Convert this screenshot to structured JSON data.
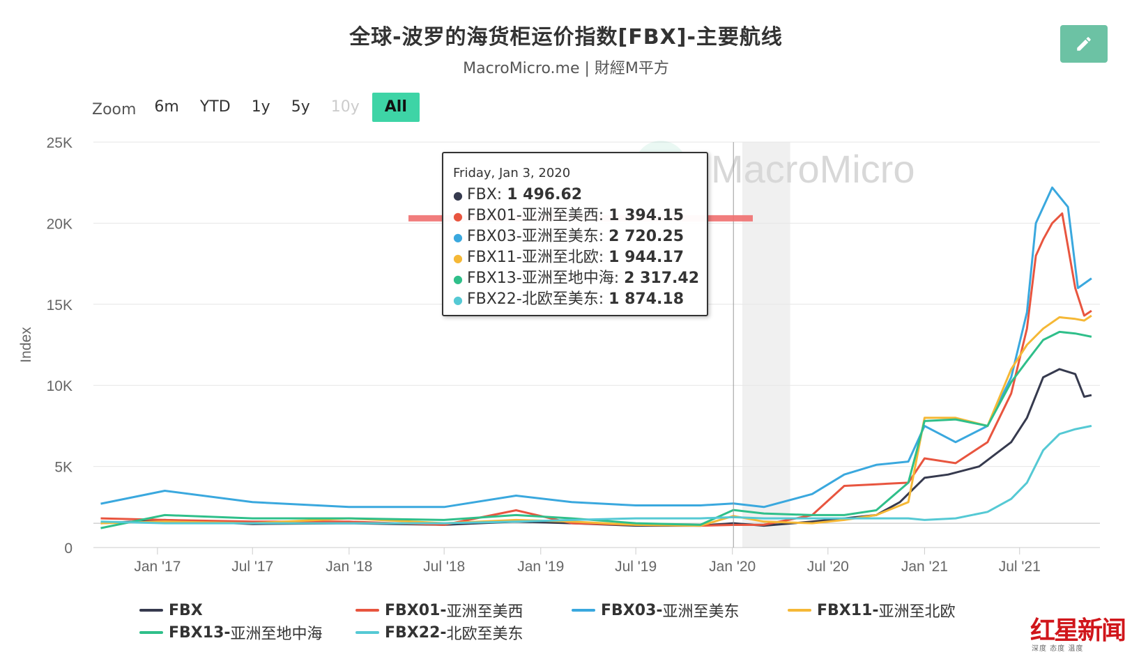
{
  "header": {
    "title": "全球-波罗的海货柜运价指数[FBX]-主要航线",
    "subtitle": "MacroMicro.me | 財經M平方",
    "edit_icon": "pencil-icon"
  },
  "zoom": {
    "label": "Zoom",
    "options": [
      {
        "label": "6m",
        "state": "normal"
      },
      {
        "label": "YTD",
        "state": "normal"
      },
      {
        "label": "1y",
        "state": "normal"
      },
      {
        "label": "5y",
        "state": "normal"
      },
      {
        "label": "10y",
        "state": "disabled"
      },
      {
        "label": "All",
        "state": "active"
      }
    ]
  },
  "watermark": "MacroMicro",
  "tooltip": {
    "date": "Friday, Jan 3, 2020",
    "rows": [
      {
        "name": "FBX",
        "value": "1 496.62",
        "color": "#363a4e"
      },
      {
        "name": "FBX01-亚洲至美西",
        "value": "1 394.15",
        "color": "#e8553f"
      },
      {
        "name": "FBX03-亚洲至美东",
        "value": "2 720.25",
        "color": "#3aa8de"
      },
      {
        "name": "FBX11-亚洲至北欧",
        "value": "1 944.17",
        "color": "#f5b836"
      },
      {
        "name": "FBX13-亚洲至地中海",
        "value": "2 317.42",
        "color": "#2fbf8a"
      },
      {
        "name": "FBX22-北欧至美东",
        "value": "1 874.18",
        "color": "#55c9d4"
      }
    ]
  },
  "legend": [
    {
      "code": "FBX",
      "name": "",
      "color": "#363a4e"
    },
    {
      "code": "FBX01-",
      "name": "亚洲至美西",
      "color": "#e8553f"
    },
    {
      "code": "FBX03-",
      "name": "亚洲至美东",
      "color": "#3aa8de"
    },
    {
      "code": "FBX11-",
      "name": "亚洲至北欧",
      "color": "#f5b836"
    },
    {
      "code": "FBX13-",
      "name": "亚洲至地中海",
      "color": "#2fbf8a"
    },
    {
      "code": "FBX22-",
      "name": "北欧至美东",
      "color": "#55c9d4"
    }
  ],
  "logo": {
    "text": "红星新闻",
    "sub": "深度 态度 温度"
  },
  "chart_data": {
    "type": "line",
    "title": "全球-波罗的海货柜运价指数[FBX]-主要航线",
    "ylabel": "Index",
    "xlabel": "",
    "ylim": [
      0,
      25000
    ],
    "y_ticks": [
      "0",
      "5K",
      "10K",
      "15K",
      "20K",
      "25K"
    ],
    "y_tick_values": [
      0,
      5000,
      10000,
      15000,
      20000,
      25000
    ],
    "x_range": [
      "2016-09-01",
      "2021-12-01"
    ],
    "x_ticks": [
      {
        "label": "Jan '17",
        "date": "2017-01-01"
      },
      {
        "label": "Jul '17",
        "date": "2017-07-01"
      },
      {
        "label": "Jan '18",
        "date": "2018-01-01"
      },
      {
        "label": "Jul '18",
        "date": "2018-07-01"
      },
      {
        "label": "Jan '19",
        "date": "2019-01-01"
      },
      {
        "label": "Jul '19",
        "date": "2019-07-01"
      },
      {
        "label": "Jan '20",
        "date": "2020-01-01"
      },
      {
        "label": "Jul '20",
        "date": "2020-07-01"
      },
      {
        "label": "Jan '21",
        "date": "2021-01-01"
      },
      {
        "label": "Jul '21",
        "date": "2021-07-01"
      }
    ],
    "shaded_range": [
      "2020-01-20",
      "2020-04-20"
    ],
    "crosshair_date": "2020-01-03",
    "reference_line_value": 20300,
    "reference_line_color": "#f07070",
    "grid": true,
    "legend_position": "bottom",
    "series": [
      {
        "name": "FBX",
        "color": "#363a4e",
        "points": [
          [
            "2016-09-15",
            1500
          ],
          [
            "2017-01-15",
            1700
          ],
          [
            "2017-07-01",
            1450
          ],
          [
            "2018-01-01",
            1500
          ],
          [
            "2018-07-01",
            1400
          ],
          [
            "2018-11-15",
            1600
          ],
          [
            "2019-03-01",
            1500
          ],
          [
            "2019-07-01",
            1350
          ],
          [
            "2019-11-01",
            1350
          ],
          [
            "2020-01-03",
            1497
          ],
          [
            "2020-03-01",
            1350
          ],
          [
            "2020-06-01",
            1600
          ],
          [
            "2020-08-01",
            1800
          ],
          [
            "2020-10-01",
            2000
          ],
          [
            "2020-11-15",
            2800
          ],
          [
            "2021-01-01",
            4300
          ],
          [
            "2021-02-15",
            4500
          ],
          [
            "2021-04-15",
            5000
          ],
          [
            "2021-06-15",
            6500
          ],
          [
            "2021-07-15",
            8000
          ],
          [
            "2021-08-15",
            10500
          ],
          [
            "2021-09-15",
            11000
          ],
          [
            "2021-10-15",
            10700
          ],
          [
            "2021-11-01",
            9300
          ],
          [
            "2021-11-15",
            9400
          ]
        ]
      },
      {
        "name": "FBX01-亚洲至美西",
        "color": "#e8553f",
        "points": [
          [
            "2016-09-15",
            1800
          ],
          [
            "2017-01-15",
            1700
          ],
          [
            "2017-07-01",
            1600
          ],
          [
            "2018-01-01",
            1600
          ],
          [
            "2018-07-01",
            1400
          ],
          [
            "2018-11-15",
            2300
          ],
          [
            "2019-03-01",
            1500
          ],
          [
            "2019-07-01",
            1400
          ],
          [
            "2019-11-01",
            1350
          ],
          [
            "2020-01-03",
            1394
          ],
          [
            "2020-03-01",
            1400
          ],
          [
            "2020-06-01",
            2000
          ],
          [
            "2020-08-01",
            3800
          ],
          [
            "2020-10-01",
            3900
          ],
          [
            "2020-12-01",
            4000
          ],
          [
            "2021-01-01",
            5500
          ],
          [
            "2021-03-01",
            5200
          ],
          [
            "2021-05-01",
            6500
          ],
          [
            "2021-06-15",
            9500
          ],
          [
            "2021-07-15",
            13500
          ],
          [
            "2021-08-01",
            18000
          ],
          [
            "2021-08-15",
            19000
          ],
          [
            "2021-09-01",
            20000
          ],
          [
            "2021-09-20",
            20600
          ],
          [
            "2021-10-15",
            16000
          ],
          [
            "2021-11-01",
            14300
          ],
          [
            "2021-11-15",
            14600
          ]
        ]
      },
      {
        "name": "FBX03-亚洲至美东",
        "color": "#3aa8de",
        "points": [
          [
            "2016-09-15",
            2700
          ],
          [
            "2017-01-15",
            3500
          ],
          [
            "2017-07-01",
            2800
          ],
          [
            "2018-01-01",
            2500
          ],
          [
            "2018-07-01",
            2500
          ],
          [
            "2018-11-15",
            3200
          ],
          [
            "2019-03-01",
            2800
          ],
          [
            "2019-07-01",
            2600
          ],
          [
            "2019-11-01",
            2600
          ],
          [
            "2020-01-03",
            2720
          ],
          [
            "2020-03-01",
            2500
          ],
          [
            "2020-06-01",
            3300
          ],
          [
            "2020-08-01",
            4500
          ],
          [
            "2020-10-01",
            5100
          ],
          [
            "2020-12-01",
            5300
          ],
          [
            "2021-01-01",
            7500
          ],
          [
            "2021-03-01",
            6500
          ],
          [
            "2021-05-01",
            7500
          ],
          [
            "2021-06-15",
            10500
          ],
          [
            "2021-07-15",
            14500
          ],
          [
            "2021-08-01",
            20000
          ],
          [
            "2021-09-01",
            22200
          ],
          [
            "2021-10-01",
            21000
          ],
          [
            "2021-10-20",
            16000
          ],
          [
            "2021-11-15",
            16600
          ]
        ]
      },
      {
        "name": "FBX11-亚洲至北欧",
        "color": "#f5b836",
        "points": [
          [
            "2016-09-15",
            1500
          ],
          [
            "2017-01-15",
            1600
          ],
          [
            "2017-07-01",
            1500
          ],
          [
            "2018-01-01",
            1800
          ],
          [
            "2018-07-01",
            1500
          ],
          [
            "2018-11-15",
            1700
          ],
          [
            "2019-03-01",
            1600
          ],
          [
            "2019-07-01",
            1400
          ],
          [
            "2019-11-01",
            1350
          ],
          [
            "2020-01-03",
            1944
          ],
          [
            "2020-03-01",
            1600
          ],
          [
            "2020-06-01",
            1500
          ],
          [
            "2020-08-01",
            1700
          ],
          [
            "2020-10-01",
            2000
          ],
          [
            "2020-12-01",
            2800
          ],
          [
            "2021-01-01",
            8000
          ],
          [
            "2021-03-01",
            8000
          ],
          [
            "2021-05-01",
            7500
          ],
          [
            "2021-06-15",
            11000
          ],
          [
            "2021-07-15",
            12500
          ],
          [
            "2021-08-15",
            13500
          ],
          [
            "2021-09-15",
            14200
          ],
          [
            "2021-10-15",
            14100
          ],
          [
            "2021-11-01",
            14000
          ],
          [
            "2021-11-15",
            14300
          ]
        ]
      },
      {
        "name": "FBX13-亚洲至地中海",
        "color": "#2fbf8a",
        "points": [
          [
            "2016-09-15",
            1200
          ],
          [
            "2017-01-15",
            2000
          ],
          [
            "2017-07-01",
            1800
          ],
          [
            "2018-01-01",
            1800
          ],
          [
            "2018-07-01",
            1700
          ],
          [
            "2018-11-15",
            2000
          ],
          [
            "2019-03-01",
            1800
          ],
          [
            "2019-07-01",
            1500
          ],
          [
            "2019-11-01",
            1400
          ],
          [
            "2020-01-03",
            2317
          ],
          [
            "2020-03-01",
            2100
          ],
          [
            "2020-06-01",
            2000
          ],
          [
            "2020-08-01",
            2000
          ],
          [
            "2020-10-01",
            2300
          ],
          [
            "2020-12-01",
            4000
          ],
          [
            "2021-01-01",
            7800
          ],
          [
            "2021-03-01",
            7900
          ],
          [
            "2021-05-01",
            7500
          ],
          [
            "2021-06-15",
            10200
          ],
          [
            "2021-07-15",
            11500
          ],
          [
            "2021-08-15",
            12800
          ],
          [
            "2021-09-15",
            13300
          ],
          [
            "2021-10-15",
            13200
          ],
          [
            "2021-11-15",
            13000
          ]
        ]
      },
      {
        "name": "FBX22-北欧至美东",
        "color": "#55c9d4",
        "points": [
          [
            "2016-09-15",
            1600
          ],
          [
            "2017-01-15",
            1500
          ],
          [
            "2017-07-01",
            1500
          ],
          [
            "2018-01-01",
            1500
          ],
          [
            "2018-07-01",
            1500
          ],
          [
            "2018-11-15",
            1600
          ],
          [
            "2019-03-01",
            1700
          ],
          [
            "2019-07-01",
            1800
          ],
          [
            "2019-11-01",
            1800
          ],
          [
            "2020-01-03",
            1874
          ],
          [
            "2020-03-01",
            1800
          ],
          [
            "2020-06-01",
            1800
          ],
          [
            "2020-08-01",
            1800
          ],
          [
            "2020-10-01",
            1800
          ],
          [
            "2020-12-01",
            1800
          ],
          [
            "2021-01-01",
            1700
          ],
          [
            "2021-03-01",
            1800
          ],
          [
            "2021-05-01",
            2200
          ],
          [
            "2021-06-15",
            3000
          ],
          [
            "2021-07-15",
            4000
          ],
          [
            "2021-08-15",
            6000
          ],
          [
            "2021-09-15",
            7000
          ],
          [
            "2021-10-15",
            7300
          ],
          [
            "2021-11-15",
            7500
          ]
        ]
      }
    ]
  }
}
